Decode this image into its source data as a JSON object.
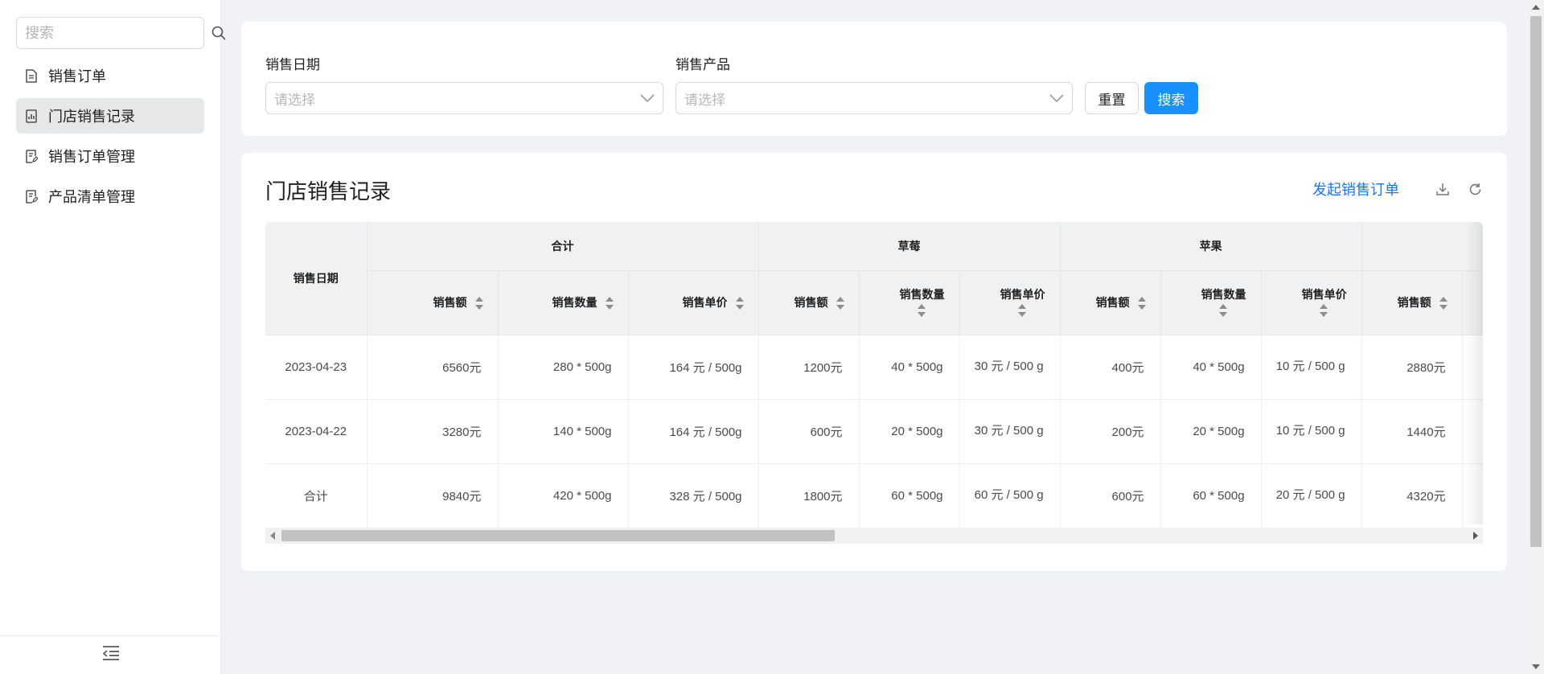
{
  "sidebar": {
    "search_placeholder": "搜索",
    "items": [
      {
        "label": "销售订单",
        "icon": "document-icon",
        "active": false
      },
      {
        "label": "门店销售记录",
        "icon": "chart-report-icon",
        "active": true
      },
      {
        "label": "销售订单管理",
        "icon": "document-edit-icon",
        "active": false
      },
      {
        "label": "产品清单管理",
        "icon": "document-edit-icon",
        "active": false
      }
    ],
    "footer_icon": "collapse-menu-icon"
  },
  "filter": {
    "date_label": "销售日期",
    "date_placeholder": "请选择",
    "product_label": "销售产品",
    "product_placeholder": "请选择",
    "reset_label": "重置",
    "search_label": "搜索"
  },
  "table": {
    "title": "门店销售记录",
    "action_link": "发起销售订单",
    "date_header": "销售日期",
    "groups": [
      "合计",
      "草莓",
      "苹果"
    ],
    "sub_headers": {
      "amount": "销售额",
      "quantity": "销售数量",
      "unit_price": "销售单价"
    },
    "rows": [
      {
        "date": "2023-04-23",
        "total": [
          "6560元",
          "280 * 500g",
          "164 元 / 500g"
        ],
        "strawberry": [
          "1200元",
          "40 * 500g",
          "30 元 / 500 g"
        ],
        "apple": [
          "400元",
          "40 * 500g",
          "10 元 / 500 g"
        ],
        "next": "2880元"
      },
      {
        "date": "2023-04-22",
        "total": [
          "3280元",
          "140 * 500g",
          "164 元 / 500g"
        ],
        "strawberry": [
          "600元",
          "20 * 500g",
          "30 元 / 500 g"
        ],
        "apple": [
          "200元",
          "20 * 500g",
          "10 元 / 500 g"
        ],
        "next": "1440元"
      },
      {
        "date": "合计",
        "total": [
          "9840元",
          "420 * 500g",
          "328 元 / 500g"
        ],
        "strawberry": [
          "1800元",
          "60 * 500g",
          "60 元 / 500 g"
        ],
        "apple": [
          "600元",
          "60 * 500g",
          "20 元 / 500 g"
        ],
        "next": "4320元"
      }
    ]
  },
  "colors": {
    "primary": "#1890ff",
    "link": "#1677ff",
    "active_nav_bg": "#e6e7e9",
    "page_bg": "#f0f2f5"
  }
}
